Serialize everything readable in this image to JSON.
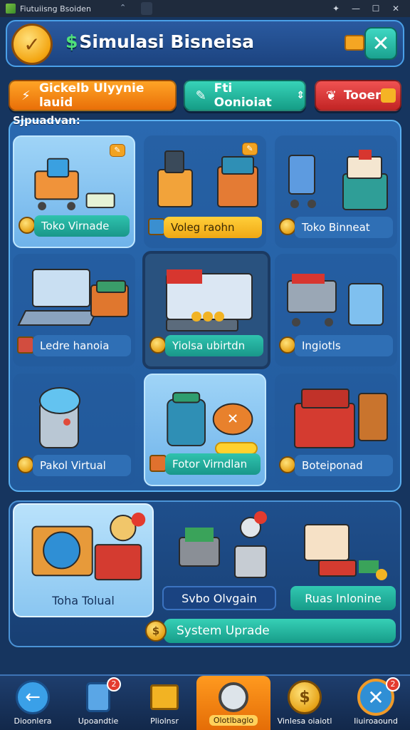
{
  "window": {
    "title": "Fiutuiisng Bsoiden",
    "icons": [
      "pin-icon",
      "minimize-icon",
      "maximize-icon",
      "close-icon"
    ]
  },
  "header": {
    "title": "Simulasi Bisneisa",
    "title_prefix": "$",
    "accent": "#4fe07a"
  },
  "actions": [
    {
      "label": "Gickelb Ulyynie lauid",
      "icon": "lightning-icon",
      "color": "#f58a16"
    },
    {
      "label": "Fti Oonioiat",
      "icon": "edit-icon",
      "color": "#22b49e"
    },
    {
      "label": "Tooer",
      "icon": "leaf-icon",
      "color": "#d83838"
    }
  ],
  "panel_label": "Sjpuadvan:",
  "cards": [
    {
      "label": "Toko Virnade",
      "style": "teal",
      "badge": "✎"
    },
    {
      "label": "Voleg raohn",
      "style": "yellow",
      "badge": "✎"
    },
    {
      "label": "Toko Binneat",
      "style": "blue"
    },
    {
      "label": "Ledre hanoia",
      "style": "blue"
    },
    {
      "label": "Yiolsa ubirtdn",
      "style": "teal"
    },
    {
      "label": "Ingiotls",
      "style": "blue"
    },
    {
      "label": "Pakol Virtual",
      "style": "blue"
    },
    {
      "label": "Fotor Virndlan",
      "style": "teal"
    },
    {
      "label": "Boteiponad",
      "style": "blue"
    }
  ],
  "lower": {
    "featured_title": "Toha Tolual",
    "btn_left": "Svbo Olvgain",
    "btn_right": "Ruas Inlonine",
    "upgrade_label": "System Uprade",
    "upgrade_coin": "$"
  },
  "nav": [
    {
      "label": "Dioonlera",
      "icon": "back-arrow-icon"
    },
    {
      "label": "Upoandtie",
      "icon": "phone-icon",
      "badge": "2"
    },
    {
      "label": "Pliolnsr",
      "icon": "box-icon"
    },
    {
      "label": "Olotlbaglo",
      "icon": "magnifier-icon",
      "active": true
    },
    {
      "label": "Vinlesa oiaiotl",
      "icon": "coin-icon"
    },
    {
      "label": "Iiuiroaound",
      "icon": "close-circle-icon",
      "badge": "2"
    }
  ]
}
